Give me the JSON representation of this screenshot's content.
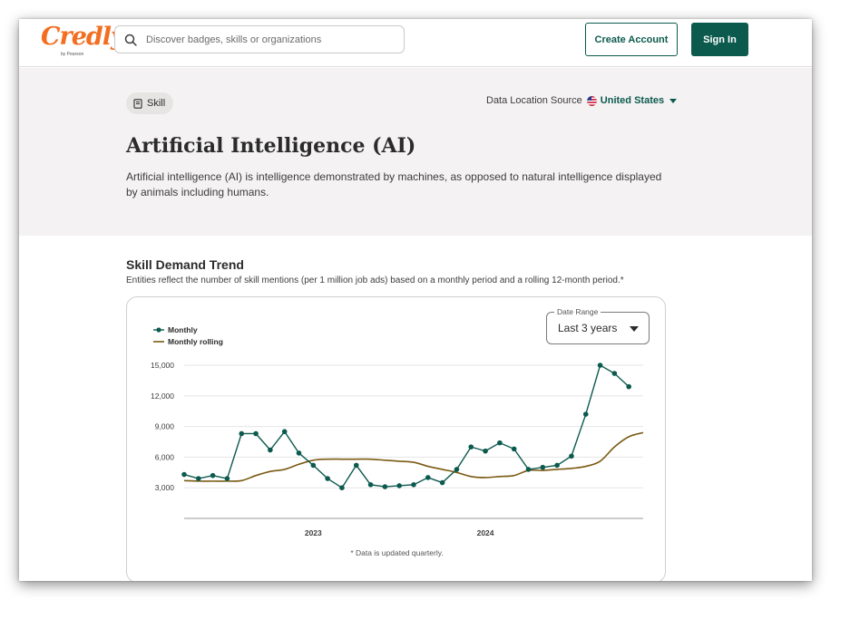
{
  "header": {
    "logo_text": "Credly",
    "logo_sub": "by Pearson",
    "search_placeholder": "Discover badges, skills or organizations",
    "create_account_label": "Create Account",
    "sign_in_label": "Sign In"
  },
  "hero": {
    "badge_label": "Skill",
    "data_location_label": "Data Location Source",
    "data_location_value": "United States",
    "title": "Artificial Intelligence (AI)",
    "description": "Artificial intelligence (AI) is intelligence demonstrated by machines, as opposed to natural intelligence displayed by animals including humans."
  },
  "trend": {
    "title": "Skill Demand Trend",
    "subtitle": "Entities reflect the number of skill mentions (per 1 million job ads) based on a monthly period and a rolling 12-month period.*",
    "date_range_label": "Date Range",
    "date_range_value": "Last 3 years",
    "note": "* Data is updated quarterly."
  },
  "colors": {
    "brand": "#f36e21",
    "accent": "#0c5a4e",
    "monthly": "#0c5a4e",
    "rolling": "#7a5a12"
  },
  "icons": {
    "search": "search-icon",
    "badge": "book-icon",
    "flag": "us-flag-icon",
    "caret": "caret-down-icon"
  },
  "chart_data": {
    "type": "line",
    "title": "",
    "xlabel": "",
    "ylabel": "",
    "ylim": [
      0,
      15000
    ],
    "yticks": [
      3000,
      6000,
      9000,
      12000,
      15000
    ],
    "ytick_labels": [
      "3,000",
      "6,000",
      "9,000",
      "12,000",
      "15,000"
    ],
    "x_start": "2022-04",
    "x_end": "2024-12",
    "xtick_labels": [
      {
        "label": "2023",
        "at": "2023-01"
      },
      {
        "label": "2024",
        "at": "2024-01"
      }
    ],
    "grid": true,
    "legend": "top-left",
    "x": [
      "2022-04",
      "2022-05",
      "2022-06",
      "2022-07",
      "2022-08",
      "2022-09",
      "2022-10",
      "2022-11",
      "2022-12",
      "2023-01",
      "2023-02",
      "2023-03",
      "2023-04",
      "2023-05",
      "2023-06",
      "2023-07",
      "2023-08",
      "2023-09",
      "2023-10",
      "2023-11",
      "2023-12",
      "2024-01",
      "2024-02",
      "2024-03",
      "2024-04",
      "2024-05",
      "2024-06",
      "2024-07",
      "2024-08",
      "2024-09",
      "2024-10",
      "2024-11",
      "2024-12"
    ],
    "series": [
      {
        "name": "Monthly",
        "values": [
          4300,
          3900,
          4200,
          3900,
          8300,
          8300,
          6700,
          8500,
          6400,
          5200,
          3900,
          3000,
          5200,
          3300,
          3100,
          3200,
          3300,
          4000,
          3500,
          4800,
          7000,
          6600,
          7400,
          6800,
          4800,
          5000,
          5200,
          6100,
          10200,
          15000,
          14200,
          12900
        ]
      },
      {
        "name": "Monthly rolling",
        "values": [
          3700,
          3650,
          3650,
          3650,
          3700,
          4200,
          4600,
          4800,
          5300,
          5700,
          5800,
          5800,
          5800,
          5800,
          5700,
          5600,
          5500,
          5100,
          4800,
          4500,
          4100,
          4000,
          4100,
          4200,
          4700,
          4700,
          4800,
          4900,
          5100,
          5600,
          7000,
          8000,
          8400
        ]
      }
    ]
  }
}
